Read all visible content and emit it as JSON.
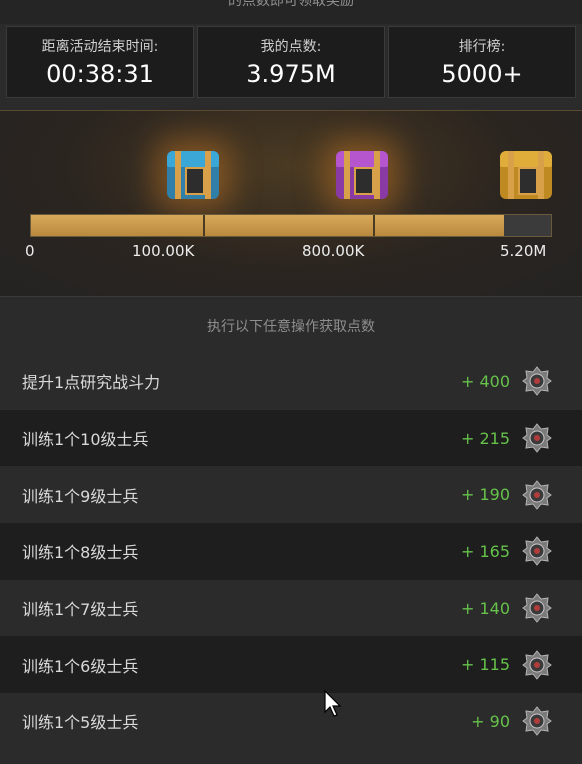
{
  "header_partial": "的点数即可领取奖励",
  "stats": [
    {
      "label": "距离活动结束时间:",
      "value": "00:38:31"
    },
    {
      "label": "我的点数:",
      "value": "3.975M"
    },
    {
      "label": "排行榜:",
      "value": "5000+"
    }
  ],
  "rewards": {
    "chest_colors": [
      "#3ba7d6",
      "#b556cf",
      "#e0ad3a"
    ],
    "milestones": [
      "0",
      "100.00K",
      "800.00K",
      "5.20M"
    ],
    "progress_fill_fraction": 0.91
  },
  "tasks_title": "执行以下任意操作获取点数",
  "tasks": [
    {
      "label": "提升1点研究战斗力",
      "points": "+ 400"
    },
    {
      "label": "训练1个10级士兵",
      "points": "+ 215"
    },
    {
      "label": "训练1个9级士兵",
      "points": "+ 190"
    },
    {
      "label": "训练1个8级士兵",
      "points": "+ 165"
    },
    {
      "label": "训练1个7级士兵",
      "points": "+ 140"
    },
    {
      "label": "训练1个6级士兵",
      "points": "+ 115"
    },
    {
      "label": "训练1个5级士兵",
      "points": "+ 90"
    }
  ],
  "colors": {
    "points_green": "#66c24a",
    "bar_gold": "#d8a95a"
  }
}
